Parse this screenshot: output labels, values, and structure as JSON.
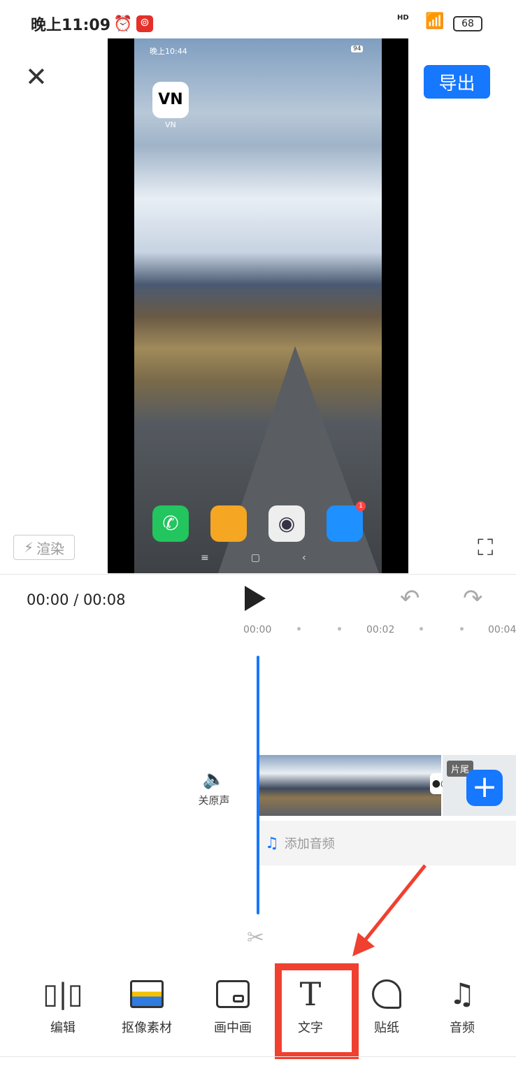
{
  "status_bar": {
    "time": "晚上11:09",
    "battery": "68",
    "hd": "HD"
  },
  "preview": {
    "inner_time": "晚上10:44",
    "inner_battery": "94",
    "app_label": "VN",
    "app_badge": "1"
  },
  "header": {
    "export_label": "导出",
    "render_label": "渲染"
  },
  "playback": {
    "time_display": "00:00 / 00:08",
    "ticks": [
      "00:00",
      "00:02",
      "00:04"
    ]
  },
  "timeline": {
    "mute_label": "关原声",
    "tail_label": "片尾",
    "add_audio_label": "添加音频"
  },
  "toolbar": {
    "items": [
      {
        "label": "编辑",
        "icon": "split-icon"
      },
      {
        "label": "抠像素材",
        "icon": "cutout-icon"
      },
      {
        "label": "画中画",
        "icon": "pip-icon"
      },
      {
        "label": "文字",
        "icon": "text-icon"
      },
      {
        "label": "贴纸",
        "icon": "sticker-icon"
      },
      {
        "label": "音频",
        "icon": "music-icon"
      }
    ]
  },
  "colors": {
    "accent": "#1677ff",
    "annotation": "#f04030"
  }
}
